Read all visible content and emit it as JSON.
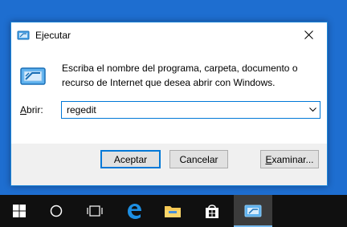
{
  "dialog": {
    "title": "Ejecutar",
    "description_line1": "Escriba el nombre del programa, carpeta, documento o",
    "description_line2": "recurso de Internet que desea abrir con Windows.",
    "open_label_accel": "A",
    "open_label_rest": "brir:",
    "open_value": "regedit",
    "ok_label": "Aceptar",
    "cancel_label": "Cancelar",
    "browse_label_accel": "E",
    "browse_label_rest": "xaminar..."
  },
  "taskbar": {
    "items": [
      {
        "icon": "windows-start-icon"
      },
      {
        "icon": "cortana-search-icon"
      },
      {
        "icon": "task-view-icon"
      },
      {
        "icon": "edge-browser-icon"
      },
      {
        "icon": "file-explorer-icon"
      },
      {
        "icon": "store-icon"
      },
      {
        "icon": "run-app-icon",
        "active": true
      }
    ]
  },
  "colors": {
    "desktop": "#1e6ed0",
    "accent": "#0078d7",
    "taskbar": "#101010",
    "dialog_footer": "#f0f0f0"
  }
}
